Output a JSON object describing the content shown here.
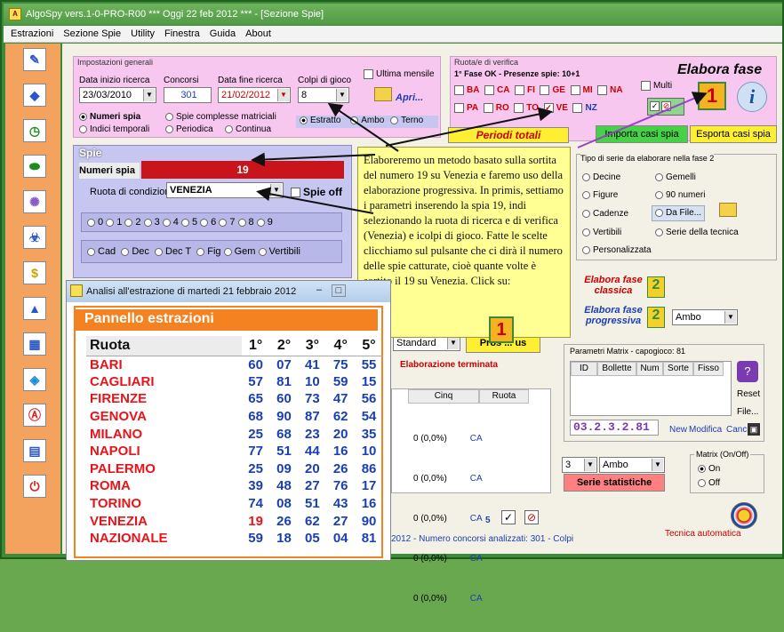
{
  "window": {
    "title": "AlgoSpy vers.1-0-PRO-R00  ***  Oggi 22 feb 2012  ***  - [Sezione Spie]"
  },
  "menu": [
    "Estrazioni",
    "Sezione Spie",
    "Utility",
    "Finestra",
    "Guida",
    "About"
  ],
  "sidebar_icons": [
    "pencil-icon",
    "diskette-icon",
    "clock-icon",
    "pill-icon",
    "lightbulb-icon",
    "biohazard-icon",
    "dollar-icon",
    "triangle-icon",
    "calendar-icon",
    "drop-icon",
    "compass-icon",
    "book-icon",
    "power-icon"
  ],
  "impostazioni": {
    "title": "Impostazioni generali",
    "data_inizio_label": "Data inizio ricerca",
    "data_inizio": "23/03/2010",
    "concorsi_label": "Concorsi",
    "concorsi": "301",
    "data_fine_label": "Data fine ricerca",
    "data_fine": "21/02/2012",
    "colpi_label": "Colpi di gioco",
    "colpi": "8",
    "ultima_mensile": "Ultima mensile",
    "apri": "Apri...",
    "numeri_spia": "Numeri spia",
    "spie_complesse": "Spie complesse matriciali",
    "indici_temporali": "Indici temporali",
    "periodica": "Periodica",
    "continua": "Continua",
    "estratto": "Estratto",
    "ambo": "Ambo",
    "terno": "Terno"
  },
  "ruote_verifica": {
    "title": "Ruota/e di verifica",
    "status": "1° Fase OK - Presenze spie: 10+1",
    "row1": [
      "BA",
      "CA",
      "FI",
      "GE",
      "MI",
      "NA"
    ],
    "row2": [
      "PA",
      "RO",
      "TO",
      "VE",
      "NZ"
    ],
    "multi": "Multi",
    "elabora_fase": "Elabora fase",
    "periodi_totali": "Periodi totali",
    "importa": "Importa casi spia",
    "esporta": "Esporta casi spia"
  },
  "spie": {
    "title": "Spie",
    "numeri_spia_label": "Numeri spia",
    "numero": "19",
    "ruota_label": "Ruota di condizione",
    "ruota": "VENEZIA",
    "spie_off": "Spie off",
    "digits": [
      "0",
      "1",
      "2",
      "3",
      "4",
      "5",
      "6",
      "7",
      "8",
      "9"
    ],
    "types": [
      "Cad",
      "Dec",
      "Dec T",
      "Fig",
      "Gem",
      "Vertibili"
    ]
  },
  "tipo_serie": {
    "title": "Tipo di serie da elaborare nella fase 2",
    "options": [
      "Decine",
      "Gemelli",
      "Figure",
      "90 numeri",
      "Cadenze",
      "Da File...",
      "Vertibili",
      "Serie della tecnica",
      "Personalizzata"
    ],
    "classica": "Elabora fase classica",
    "progressiva": "Elabora fase progressiva",
    "ambo": "Ambo"
  },
  "tooltip": "Elaboreremo un metodo basato sulla sortita del numero 19 su Venezia e faremo uso della elaborazione progressiva. In primis, settiamo i parametri inserendo la spia 19, indi selezionando la ruota di ricerca e di verifica (Venezia) e icolpi di gioco. Fatte le scelte clicchiamo sul pulsante che ci dirà il numero delle spie catturate, cioè quante volte è sortito il 19 su Venezia. Click su:",
  "middle": {
    "standard": "Standard",
    "pros": "Pros",
    "us": "us",
    "terminata": "Elaborazione terminata",
    "cols": [
      "Cinq",
      "Ruota"
    ],
    "rows": [
      [
        "0 (0,0%)",
        "CA"
      ],
      [
        "0 (0,0%)",
        "CA"
      ],
      [
        "0 (0,0%)",
        "CA"
      ],
      [
        "0 (0,0%)",
        "CA"
      ],
      [
        "0 (0,0%)",
        "CA"
      ]
    ],
    "count": "5",
    "status": "2012 - Numero concorsi analizzati: 301 - Colpi"
  },
  "matrix": {
    "title": "Parametri Matrix - capogioco: 81",
    "cols": [
      "ID",
      "Bollette",
      "Num",
      "Sorte",
      "Fisso"
    ],
    "code": "03.2.3.2.81",
    "new": "New",
    "modifica": "Modifica",
    "canc": "Canc",
    "reset": "Reset",
    "file": "File...",
    "stat_num": "3",
    "stat_ambo": "Ambo",
    "serie_statistiche": "Serie statistiche",
    "onoff_title": "Matrix (On/Off)",
    "on": "On",
    "off": "Off",
    "tecnica": "Tecnica automatica"
  },
  "subwindow": {
    "title": "Analisi all'estrazione di martedi 21 febbraio 2012",
    "panel_title": "Pannello estrazioni",
    "headers": [
      "Ruota",
      "1°",
      "2°",
      "3°",
      "4°",
      "5°"
    ],
    "rows": [
      [
        "BARI",
        "60",
        "07",
        "41",
        "75",
        "55"
      ],
      [
        "CAGLIARI",
        "57",
        "81",
        "10",
        "59",
        "15"
      ],
      [
        "FIRENZE",
        "65",
        "60",
        "73",
        "47",
        "56"
      ],
      [
        "GENOVA",
        "68",
        "90",
        "87",
        "62",
        "54"
      ],
      [
        "MILANO",
        "25",
        "68",
        "23",
        "20",
        "35"
      ],
      [
        "NAPOLI",
        "77",
        "51",
        "44",
        "16",
        "10"
      ],
      [
        "PALERMO",
        "25",
        "09",
        "20",
        "26",
        "86"
      ],
      [
        "ROMA",
        "39",
        "48",
        "27",
        "76",
        "17"
      ],
      [
        "TORINO",
        "74",
        "08",
        "51",
        "43",
        "16"
      ],
      [
        "VENEZIA",
        "19",
        "26",
        "62",
        "27",
        "90"
      ],
      [
        "NAZIONALE",
        "59",
        "18",
        "05",
        "04",
        "81"
      ]
    ]
  }
}
